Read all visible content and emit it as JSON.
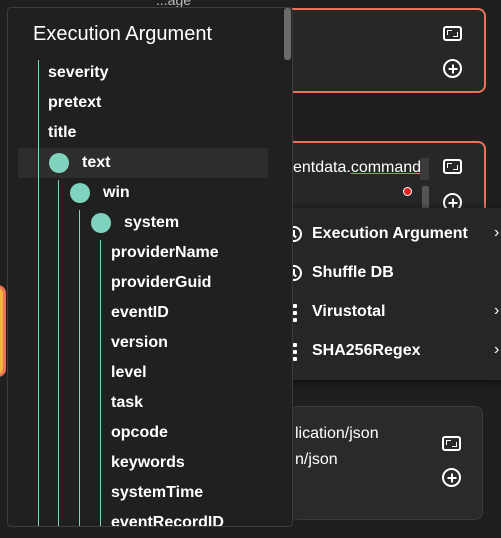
{
  "background": {
    "top_fragment": "...age",
    "mid_card_text_prefix": "entdata.",
    "mid_card_text_underlined": "command",
    "bottom_card_lines": [
      "lication/json",
      "n/json"
    ]
  },
  "context_menu": {
    "items": [
      {
        "label": "Execution Argument",
        "icon": "clock-icon",
        "arrow": "›"
      },
      {
        "label": "Shuffle DB",
        "icon": "clock-icon",
        "arrow": ""
      },
      {
        "label": "Virustotal",
        "icon": "vertical-dots-icon",
        "arrow": "›"
      },
      {
        "label": "SHA256Regex",
        "icon": "vertical-dots-icon",
        "arrow": "›"
      }
    ]
  },
  "arg_panel": {
    "title": "Execution Argument",
    "items": [
      {
        "label": "severity"
      },
      {
        "label": "pretext"
      },
      {
        "label": "title"
      },
      {
        "label": "text"
      },
      {
        "label": "win"
      },
      {
        "label": "system"
      },
      {
        "label": "providerName"
      },
      {
        "label": "providerGuid"
      },
      {
        "label": "eventID"
      },
      {
        "label": "version"
      },
      {
        "label": "level"
      },
      {
        "label": "task"
      },
      {
        "label": "opcode"
      },
      {
        "label": "keywords"
      },
      {
        "label": "systemTime"
      },
      {
        "label": "eventRecordID"
      }
    ]
  },
  "colors": {
    "accent_teal": "#7fd3bf",
    "card_border_orange": "#e8735a",
    "error_red": "#e52222"
  }
}
